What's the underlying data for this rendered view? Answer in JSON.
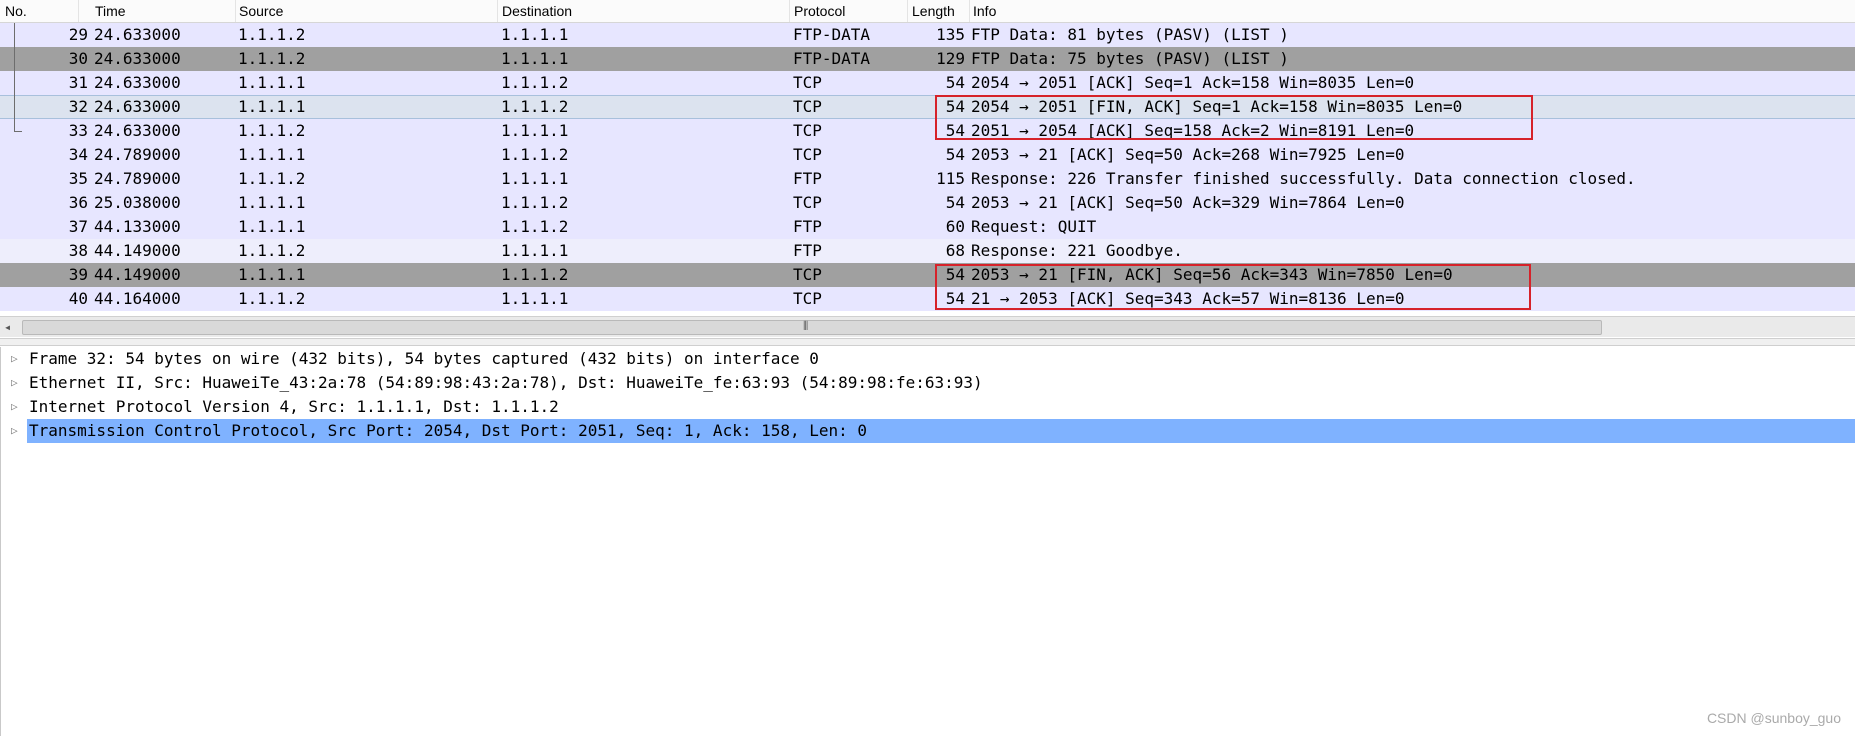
{
  "columns": {
    "no": "No.",
    "time": "Time",
    "source": "Source",
    "destination": "Destination",
    "protocol": "Protocol",
    "length": "Length",
    "info": "Info"
  },
  "packets": [
    {
      "no": "29",
      "time": "24.633000",
      "src": "1.1.1.2",
      "dst": "1.1.1.1",
      "proto": "FTP-DATA",
      "len": "135",
      "info": "FTP Data: 81 bytes (PASV) (LIST )"
    },
    {
      "no": "30",
      "time": "24.633000",
      "src": "1.1.1.2",
      "dst": "1.1.1.1",
      "proto": "FTP-DATA",
      "len": "129",
      "info": "FTP Data: 75 bytes (PASV) (LIST )"
    },
    {
      "no": "31",
      "time": "24.633000",
      "src": "1.1.1.1",
      "dst": "1.1.1.2",
      "proto": "TCP",
      "len": "54",
      "info": "2054 → 2051 [ACK] Seq=1 Ack=158 Win=8035 Len=0"
    },
    {
      "no": "32",
      "time": "24.633000",
      "src": "1.1.1.1",
      "dst": "1.1.1.2",
      "proto": "TCP",
      "len": "54",
      "info": "2054 → 2051 [FIN, ACK] Seq=1 Ack=158 Win=8035 Len=0"
    },
    {
      "no": "33",
      "time": "24.633000",
      "src": "1.1.1.2",
      "dst": "1.1.1.1",
      "proto": "TCP",
      "len": "54",
      "info": "2051 → 2054 [ACK] Seq=158 Ack=2 Win=8191 Len=0"
    },
    {
      "no": "34",
      "time": "24.789000",
      "src": "1.1.1.1",
      "dst": "1.1.1.2",
      "proto": "TCP",
      "len": "54",
      "info": "2053 → 21 [ACK] Seq=50 Ack=268 Win=7925 Len=0"
    },
    {
      "no": "35",
      "time": "24.789000",
      "src": "1.1.1.2",
      "dst": "1.1.1.1",
      "proto": "FTP",
      "len": "115",
      "info": "Response: 226 Transfer finished successfully. Data connection closed."
    },
    {
      "no": "36",
      "time": "25.038000",
      "src": "1.1.1.1",
      "dst": "1.1.1.2",
      "proto": "TCP",
      "len": "54",
      "info": "2053 → 21 [ACK] Seq=50 Ack=329 Win=7864 Len=0"
    },
    {
      "no": "37",
      "time": "44.133000",
      "src": "1.1.1.1",
      "dst": "1.1.1.2",
      "proto": "FTP",
      "len": "60",
      "info": "Request: QUIT"
    },
    {
      "no": "38",
      "time": "44.149000",
      "src": "1.1.1.2",
      "dst": "1.1.1.1",
      "proto": "FTP",
      "len": "68",
      "info": "Response: 221 Goodbye."
    },
    {
      "no": "39",
      "time": "44.149000",
      "src": "1.1.1.1",
      "dst": "1.1.1.2",
      "proto": "TCP",
      "len": "54",
      "info": "2053 → 21 [FIN, ACK] Seq=56 Ack=343 Win=7850 Len=0"
    },
    {
      "no": "40",
      "time": "44.164000",
      "src": "1.1.1.2",
      "dst": "1.1.1.1",
      "proto": "TCP",
      "len": "54",
      "info": "21 → 2053 [ACK] Seq=343 Ack=57 Win=8136 Len=0"
    }
  ],
  "scrollbar": {
    "left_arrow": "◂",
    "grip": "⦀"
  },
  "details": [
    {
      "expander": "▷",
      "text": "Frame 32: 54 bytes on wire (432 bits), 54 bytes captured (432 bits) on interface 0"
    },
    {
      "expander": "▷",
      "text": "Ethernet II, Src: HuaweiTe_43:2a:78 (54:89:98:43:2a:78), Dst: HuaweiTe_fe:63:93 (54:89:98:fe:63:93)"
    },
    {
      "expander": "▷",
      "text": "Internet Protocol Version 4, Src: 1.1.1.1, Dst: 1.1.1.2"
    },
    {
      "expander": "▷",
      "text": "Transmission Control Protocol, Src Port: 2054, Dst Port: 2051, Seq: 1, Ack: 158, Len: 0"
    }
  ],
  "watermark": "CSDN @sunboy_guo",
  "colors": {
    "row_light": "#e7e6ff",
    "row_dark": "#a0a0a0",
    "row_selected": "#dce3ef",
    "detail_selected": "#7fb2ff",
    "highlight_box": "#d6222a"
  }
}
